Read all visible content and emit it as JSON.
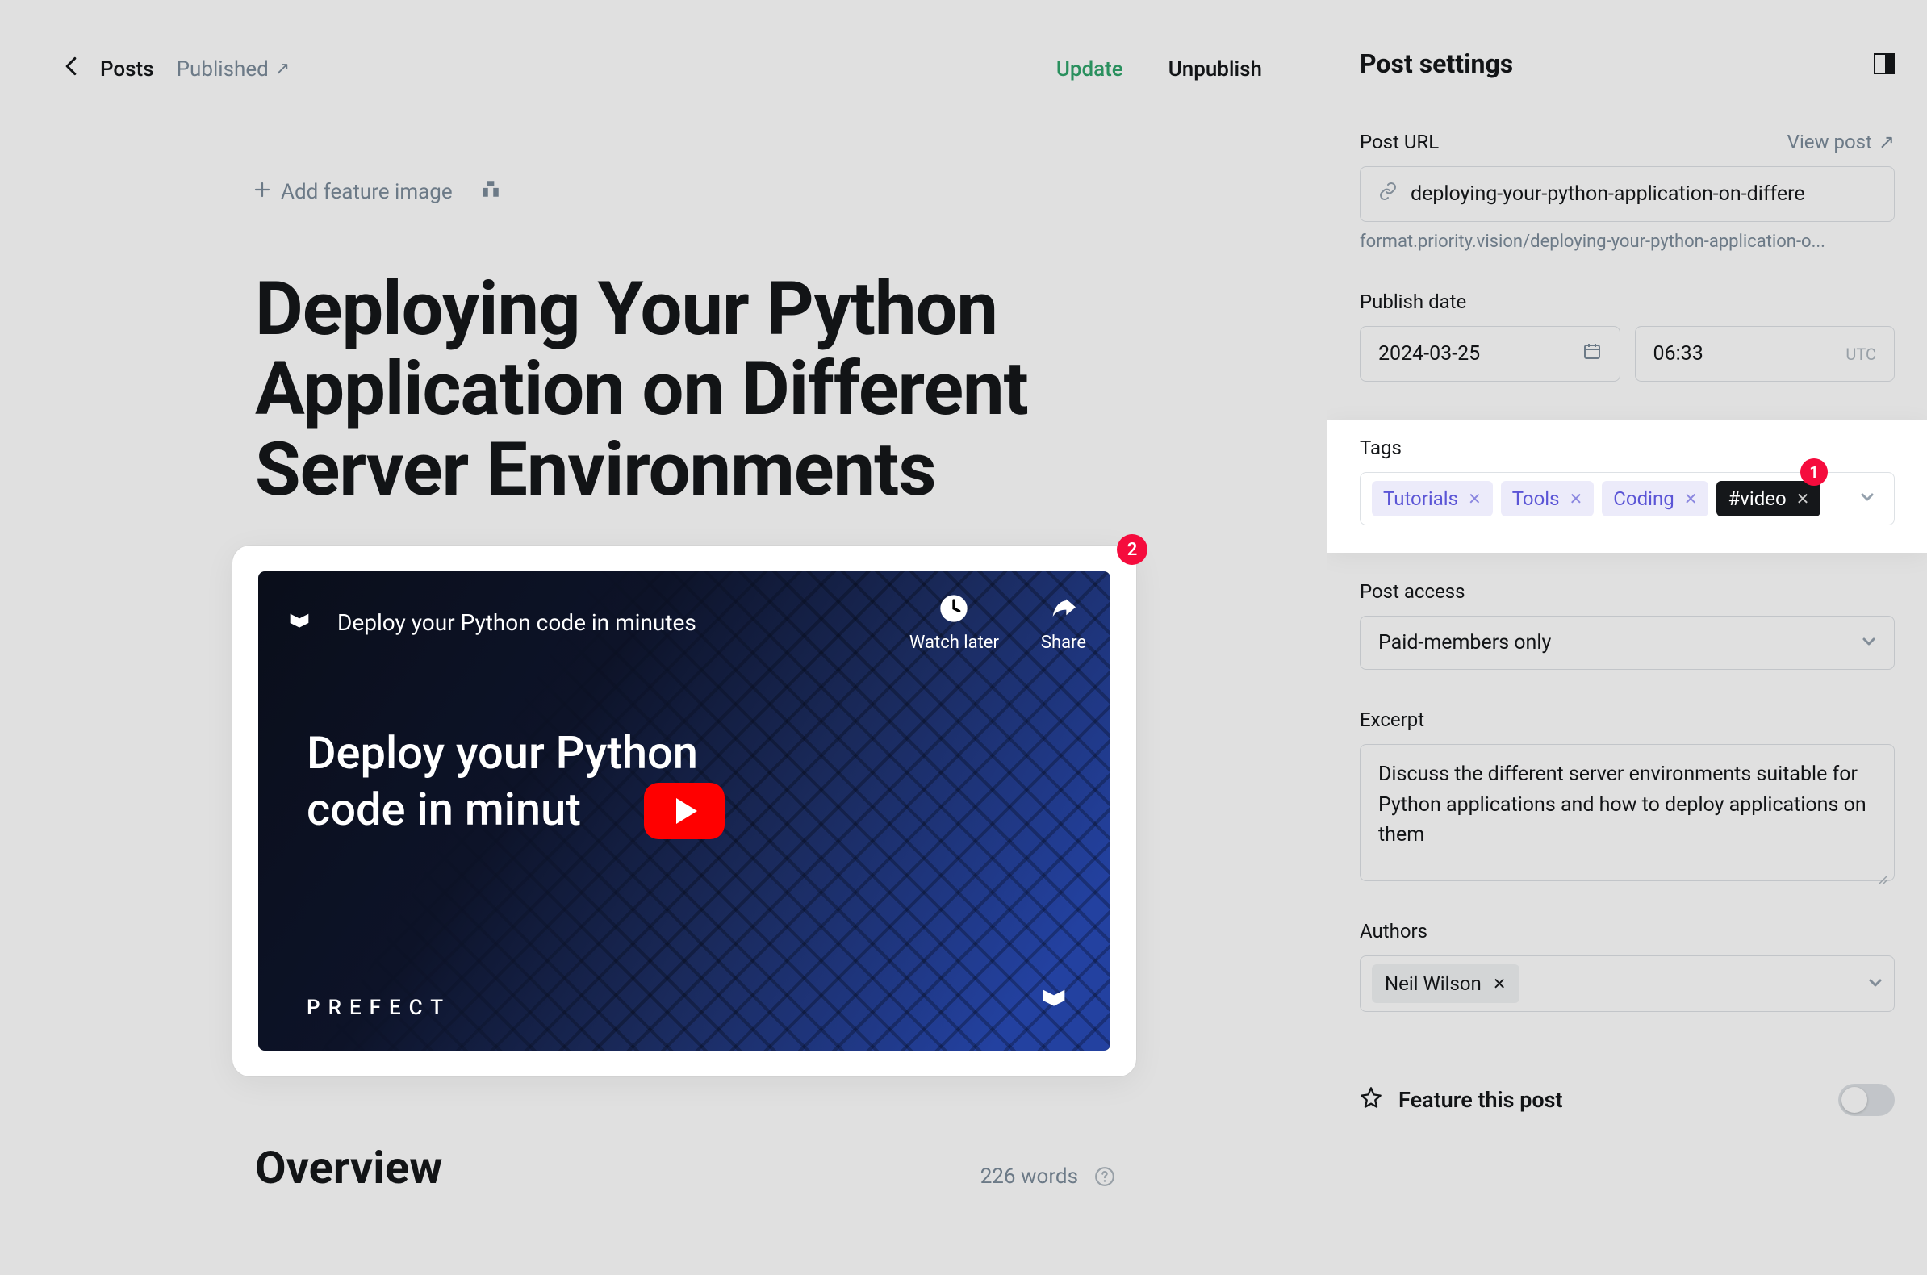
{
  "header": {
    "posts_label": "Posts",
    "status_label": "Published",
    "update_label": "Update",
    "unpublish_label": "Unpublish"
  },
  "content": {
    "add_feature_image": "Add feature image",
    "title": "Deploying Your Python Application on Different Server Environments",
    "video": {
      "embed_title": "Deploy your Python code in minutes",
      "watch_later": "Watch later",
      "share": "Share",
      "headline_line1": "Deploy your Python",
      "headline_line2": "code in minut",
      "brand": "PREFECT"
    },
    "overview_heading": "Overview",
    "word_count": "226 words"
  },
  "sidebar": {
    "title": "Post settings",
    "post_url": {
      "label": "Post URL",
      "view_post": "View post",
      "value": "deploying-your-python-application-on-differe",
      "preview": "format.priority.vision/deploying-your-python-application-o..."
    },
    "publish_date": {
      "label": "Publish date",
      "date": "2024-03-25",
      "time": "06:33",
      "tz": "UTC"
    },
    "tags": {
      "label": "Tags",
      "items": [
        {
          "name": "Tutorials",
          "style": "purple"
        },
        {
          "name": "Tools",
          "style": "purple"
        },
        {
          "name": "Coding",
          "style": "purple"
        },
        {
          "name": "#video",
          "style": "dark"
        }
      ]
    },
    "post_access": {
      "label": "Post access",
      "value": "Paid-members only"
    },
    "excerpt": {
      "label": "Excerpt",
      "value": "Discuss the different server environments suitable for Python applications and how to deploy applications on them"
    },
    "authors": {
      "label": "Authors",
      "value": "Neil Wilson"
    },
    "feature_post": "Feature this post"
  },
  "badges": {
    "video": "2",
    "tags": "1"
  }
}
